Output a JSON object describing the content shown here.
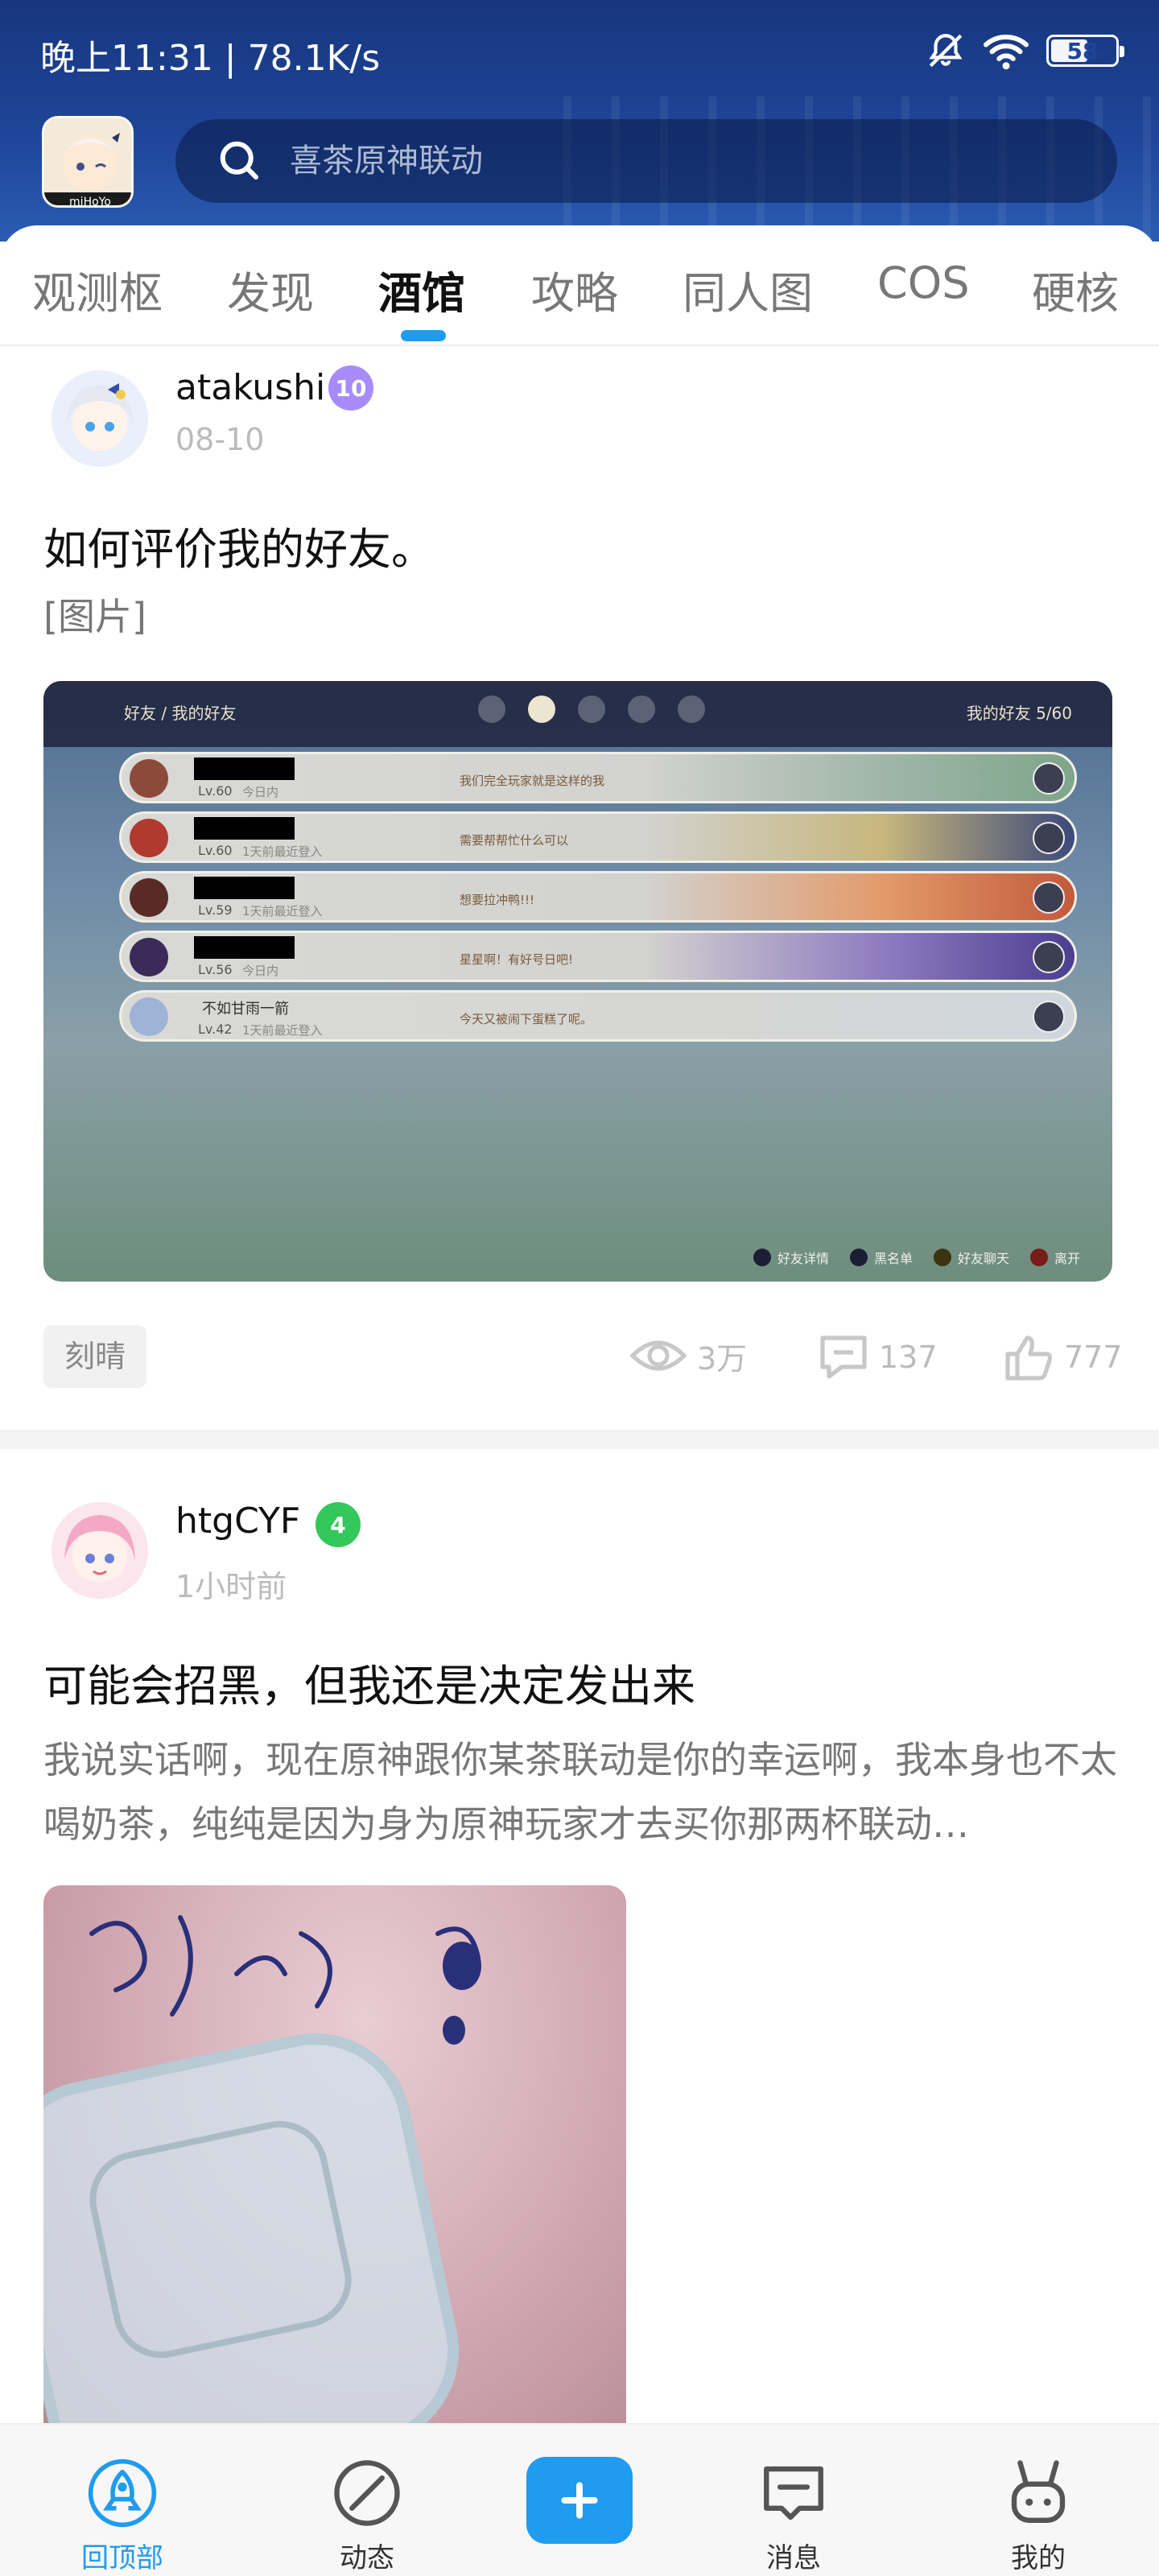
{
  "status_bar": {
    "time_speed": "晚上11:31 | 78.1K/s",
    "battery": "58",
    "battery_level_pct": 58
  },
  "search": {
    "placeholder": "喜茶原神联动"
  },
  "app_logo": {
    "label": "miHoYo"
  },
  "tabs": [
    {
      "label": "观测枢"
    },
    {
      "label": "发现"
    },
    {
      "label": "酒馆",
      "active": true
    },
    {
      "label": "攻略"
    },
    {
      "label": "同人图"
    },
    {
      "label": "COS"
    },
    {
      "label": "硬核"
    }
  ],
  "posts": [
    {
      "author": "atakushi",
      "level": "10",
      "level_color": "#a78bfa",
      "time": "08-10",
      "title": "如何评价我的好友。",
      "body": "[图片]",
      "tag": "刻晴",
      "views": "3万",
      "comments": "137",
      "likes": "777",
      "image": {
        "topbar_left": "好友 / 我的好友",
        "topbar_right": "我的好友 5/60",
        "friends": [
          {
            "name": "",
            "level": "Lv.60",
            "status": "今日内",
            "message": "我们完全玩家就是这样的我"
          },
          {
            "name": "",
            "level": "Lv.60",
            "status": "1天前最近登入",
            "message": "需要帮帮忙什么可以"
          },
          {
            "name": "",
            "level": "Lv.59",
            "status": "1天前最近登入",
            "message": "想要拉冲鸭!!!"
          },
          {
            "name": "",
            "level": "Lv.56",
            "status": "今日内",
            "message": "星星啊！有好号日吧!"
          },
          {
            "name": "不如甘雨一箭",
            "level": "Lv.42",
            "status": "1天前最近登入",
            "message": "今天又被闹下蛋糕了呢。"
          }
        ],
        "bottom_buttons": [
          "好友详情",
          "黑名单",
          "好友聊天",
          "离开"
        ]
      }
    },
    {
      "author": "htgCYF",
      "level": "4",
      "level_color": "#34c759",
      "time": "1小时前",
      "title": "可能会招黑，但我还是决定发出来",
      "body": "我说实话啊，现在原神跟你某茶联动是你的幸运啊，我本身也不太喝奶茶，纯纯是因为身为原神玩家才去买你那两杯联动…"
    }
  ],
  "bottom_nav": {
    "home": "回顶部",
    "feed": "动态",
    "messages": "消息",
    "mine": "我的"
  },
  "colors": {
    "accent": "#1f9bf0",
    "header_bg": "#1f4598"
  }
}
